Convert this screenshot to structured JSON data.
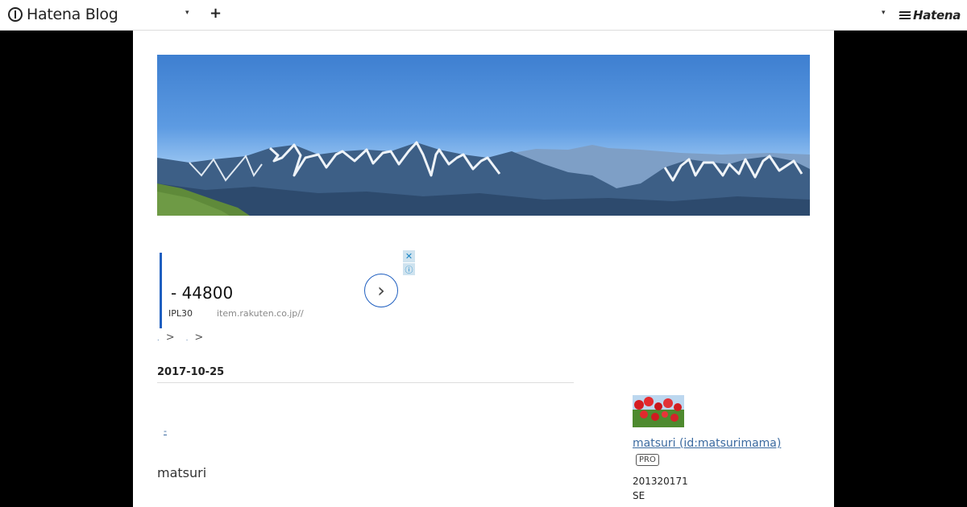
{
  "globalbar": {
    "brand_name": "Hatena Blog",
    "logo_icon": "hatena-blog-logo-icon",
    "menu_caret": "▾",
    "add_label": "+",
    "right_caret": "▾",
    "hatena_label": "Hatena"
  },
  "ad": {
    "price": "- 44800",
    "sub": "IPL30",
    "url": "item.rakuten.co.jp//",
    "arrow": "›",
    "close": "✕",
    "info": "ⓘ",
    "accent_color": "#1f5fc0"
  },
  "breadcrumb": {
    "item1": ">",
    "item2": ">"
  },
  "entry": {
    "date": "2017-10-25",
    "link_text": "-",
    "text": "matsuri"
  },
  "sidebar": {
    "profile_name": "matsuri (id:matsurimama)",
    "badge": "PRO",
    "line1": "201320171",
    "line2": "SE"
  },
  "colors": {
    "link": "#3b6aa0",
    "background": "#000000",
    "page": "#ffffff"
  }
}
